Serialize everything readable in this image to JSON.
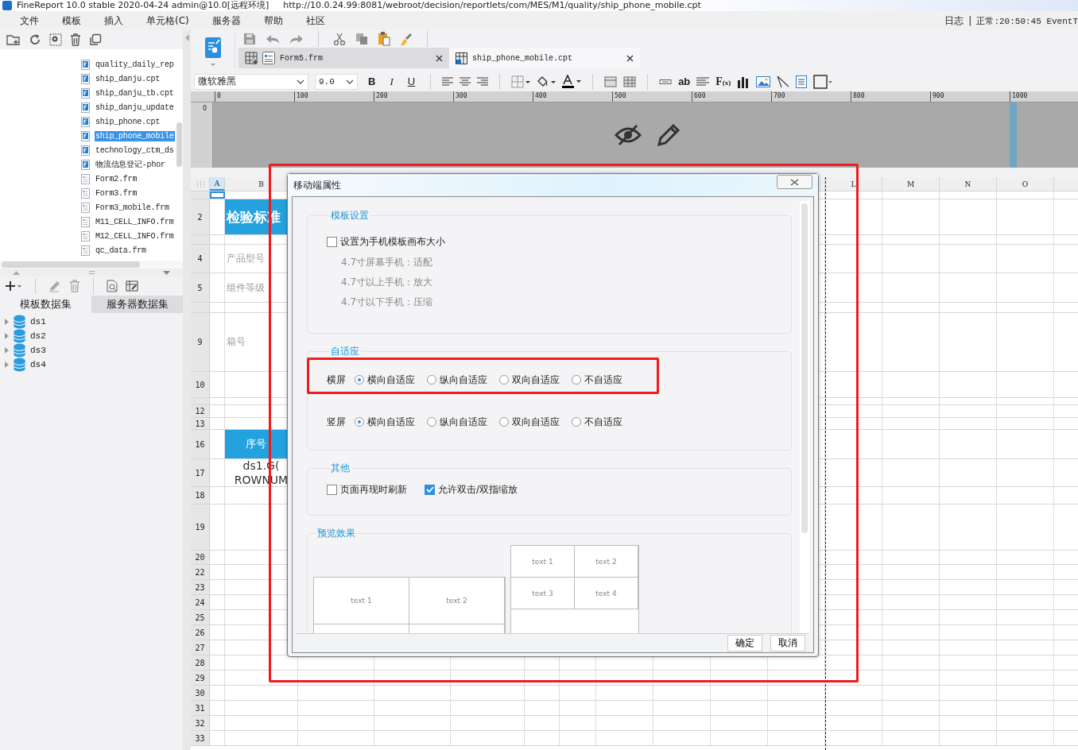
{
  "title_bar": {
    "text": "FineReport 10.0 stable 2020-04-24 admin@10.0[远程环境]",
    "url": "http://10.0.24.99:8081/webroot/decision/reportlets/com/MES/M1/quality/ship_phone_mobile.cpt"
  },
  "menu": [
    "文件",
    "模板",
    "插入",
    "单元格(C)",
    "服务器",
    "帮助",
    "社区"
  ],
  "status": {
    "log": "日志",
    "separator": "|",
    "state": "正常:20:50:45 EventT"
  },
  "file_tree": [
    {
      "name": "quality_daily_rep",
      "kind": "cpt",
      "selected": false
    },
    {
      "name": "ship_danju.cpt",
      "kind": "cpt",
      "selected": false
    },
    {
      "name": "ship_danju_tb.cpt",
      "kind": "cpt",
      "selected": false
    },
    {
      "name": "ship_danju_update",
      "kind": "cpt",
      "selected": false
    },
    {
      "name": "ship_phone.cpt",
      "kind": "cpt",
      "selected": false
    },
    {
      "name": "ship_phone_mobile",
      "kind": "cpt",
      "selected": true
    },
    {
      "name": "technology_ctm_ds",
      "kind": "cpt",
      "selected": false
    },
    {
      "name": "物流信息登记-phor",
      "kind": "cpt",
      "selected": false
    },
    {
      "name": "Form2.frm",
      "kind": "frm",
      "selected": false
    },
    {
      "name": "Form3.frm",
      "kind": "frm",
      "selected": false
    },
    {
      "name": "Form3_mobile.frm",
      "kind": "frm",
      "selected": false
    },
    {
      "name": "M11_CELL_INFO.frm",
      "kind": "frm",
      "selected": false
    },
    {
      "name": "M12_CELL_INFO.frm",
      "kind": "frm",
      "selected": false
    },
    {
      "name": "qc_data.frm",
      "kind": "frm",
      "selected": false
    }
  ],
  "dataset_tabs": [
    {
      "label": "模板数据集",
      "selected": true
    },
    {
      "label": "服务器数据集",
      "selected": false
    }
  ],
  "datasets": [
    {
      "name": "ds1",
      "expanded": false
    },
    {
      "name": "ds2",
      "expanded": false
    },
    {
      "name": "ds3",
      "expanded": false
    },
    {
      "name": "ds4",
      "expanded": false
    }
  ],
  "template_tabs": [
    {
      "label": "Form5.frm",
      "kind": "frm",
      "selected": false
    },
    {
      "label": "ship_phone_mobile.cpt",
      "kind": "cpt",
      "selected": true
    }
  ],
  "format_bar": {
    "font": "微软雅黑",
    "font_size": "9.0",
    "bold": "B",
    "italic": "I",
    "underline": "U",
    "text_tool": "ab",
    "formula": "F$_{(x)}$"
  },
  "ruler": [
    "0",
    "100",
    "200",
    "300",
    "400",
    "500",
    "600",
    "700",
    "800",
    "900",
    "1000"
  ],
  "vertical_ruler": "0",
  "sheet": {
    "columns": [
      {
        "label": "A",
        "selected": true
      },
      {
        "label": "B",
        "selected": false
      },
      {
        "label": "L",
        "selected": false
      },
      {
        "label": "M",
        "selected": false
      },
      {
        "label": "N",
        "selected": false
      },
      {
        "label": "O",
        "selected": false
      }
    ],
    "rows": [
      {
        "kind": "spacer"
      },
      {
        "kind": "row",
        "number": "2",
        "cell": {
          "kind": "heading",
          "text": "检验标准"
        }
      },
      {
        "kind": "spacer"
      },
      {
        "kind": "row",
        "number": "4",
        "cell": {
          "kind": "label",
          "text": "产品型号"
        }
      },
      {
        "kind": "row",
        "number": "5",
        "cell": {
          "kind": "label",
          "text": "组件等级"
        }
      },
      {
        "kind": "spacer"
      },
      {
        "kind": "row",
        "number": "9",
        "cell": {
          "kind": "label",
          "text": "箱号"
        }
      },
      {
        "kind": "row",
        "number": "10"
      },
      {
        "kind": "spacer"
      },
      {
        "kind": "row",
        "number": "12"
      },
      {
        "kind": "row",
        "number": "13"
      },
      {
        "kind": "row",
        "number": "16",
        "cell": {
          "kind": "column_heading",
          "text": "序号"
        }
      },
      {
        "kind": "row",
        "number": "17",
        "cell": {
          "kind": "formula",
          "text": "ds1.G(\nROWNUM"
        }
      },
      {
        "kind": "row",
        "number": "18"
      },
      {
        "kind": "row",
        "number": "19"
      },
      {
        "kind": "row",
        "number": "20"
      },
      {
        "kind": "row",
        "number": "22"
      },
      {
        "kind": "row",
        "number": "23"
      },
      {
        "kind": "row",
        "number": "24"
      },
      {
        "kind": "row",
        "number": "25"
      },
      {
        "kind": "row",
        "number": "26"
      },
      {
        "kind": "row",
        "number": "27"
      },
      {
        "kind": "row",
        "number": "28"
      },
      {
        "kind": "row",
        "number": "29"
      },
      {
        "kind": "row",
        "number": "30"
      },
      {
        "kind": "row",
        "number": "31"
      },
      {
        "kind": "row",
        "number": "32"
      },
      {
        "kind": "row",
        "number": "33"
      }
    ]
  },
  "dialog": {
    "title": "移动端属性",
    "highlighted": true,
    "sections": [
      {
        "kind": "template",
        "title": "模板设置",
        "checkbox": {
          "label": "设置为手机模板画布大小",
          "checked": false
        },
        "notes": [
          "4.7寸屏幕手机：适配",
          "4.7寸以上手机：放大",
          "4.7寸以下手机：压缩"
        ]
      },
      {
        "kind": "adaptive",
        "title": "自适应",
        "rows": [
          {
            "label": "横屏",
            "highlighted": true,
            "options": [
              {
                "label": "横向自适应",
                "selected": true
              },
              {
                "label": "纵向自适应",
                "selected": false
              },
              {
                "label": "双向自适应",
                "selected": false
              },
              {
                "label": "不自适应",
                "selected": false
              }
            ]
          },
          {
            "label": "竖屏",
            "highlighted": false,
            "options": [
              {
                "label": "横向自适应",
                "selected": true
              },
              {
                "label": "纵向自适应",
                "selected": false
              },
              {
                "label": "双向自适应",
                "selected": false
              },
              {
                "label": "不自适应",
                "selected": false
              }
            ]
          }
        ]
      },
      {
        "kind": "other",
        "title": "其他",
        "checkboxes": [
          {
            "label": "页面再现时刷新",
            "checked": false
          },
          {
            "label": "允许双击/双指缩放",
            "checked": true
          }
        ]
      },
      {
        "kind": "preview",
        "title": "预览效果",
        "landscape": [
          "text 1",
          "text 2"
        ],
        "portrait": [
          "text 1",
          "text 2",
          "text 3",
          "text 4"
        ]
      }
    ],
    "buttons": [
      "确定",
      "取消"
    ]
  }
}
